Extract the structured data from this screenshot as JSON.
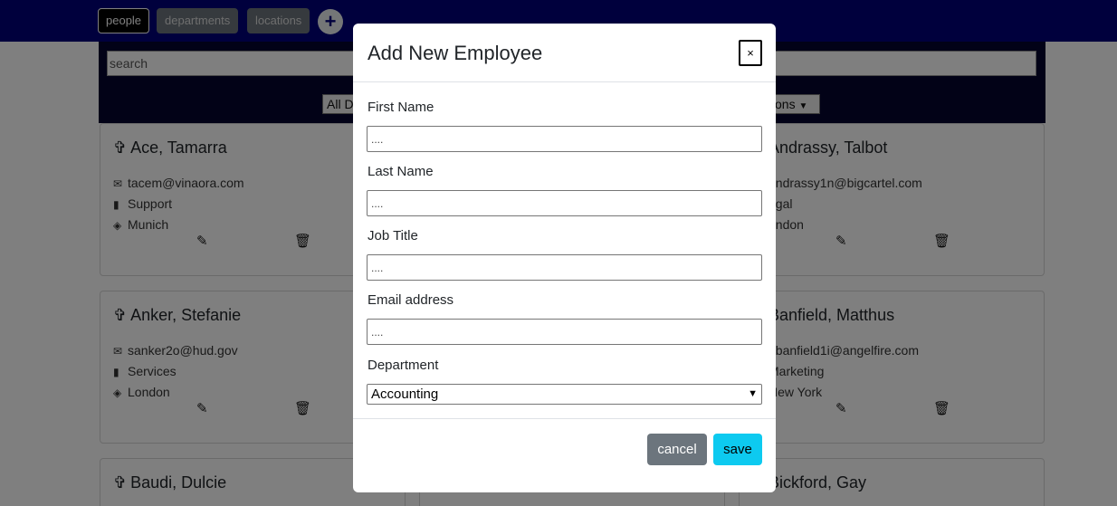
{
  "navbar": {
    "tabs": [
      {
        "label": "people",
        "active": true
      },
      {
        "label": "departments",
        "active": false
      },
      {
        "label": "locations",
        "active": false
      }
    ],
    "add_icon": "plus-icon",
    "add_label": "+"
  },
  "filters": {
    "search_placeholder": "search",
    "department_select": "All D",
    "location_select": "tions"
  },
  "cards": [
    {
      "name": "Ace, Tamarra",
      "email": "tacem@vinaora.com",
      "department": "Support",
      "location": "Munich"
    },
    {
      "name": "Andrassy, Talbot",
      "email": "andrassy1n@bigcartel.com",
      "department": "egal",
      "location": "ondon"
    },
    {
      "name": "Anker, Stefanie",
      "email": "sanker2o@hud.gov",
      "department": "Services",
      "location": "London"
    },
    {
      "name": "Banfield, Matthus",
      "email": "nbanfield1i@angelfire.com",
      "department": "Marketing",
      "location": "New York"
    },
    {
      "name": "Baudi, Dulcie",
      "email": "",
      "department": "",
      "location": ""
    },
    {
      "name": "Bickford, Gay",
      "email": "",
      "department": "",
      "location": ""
    }
  ],
  "icons": {
    "person": "person-icon",
    "email": "envelope-icon",
    "department": "book-icon",
    "location": "crosshair-icon",
    "edit": "edit-icon",
    "delete": "trash-icon"
  },
  "modal": {
    "title": "Add New Employee",
    "close_label": "×",
    "fields": {
      "first_name_label": "First Name",
      "first_name_placeholder": "....",
      "last_name_label": "Last Name",
      "last_name_placeholder": "....",
      "job_title_label": "Job Title",
      "job_title_placeholder": "....",
      "email_label": "Email address",
      "email_placeholder": "....",
      "department_label": "Department",
      "department_value": "Accounting"
    },
    "cancel_label": "cancel",
    "save_label": "save"
  },
  "colors": {
    "navbar": "#00007a",
    "filter_bar": "#05052e",
    "save_button": "#0dcaf0",
    "cancel_button": "#6c757d"
  }
}
